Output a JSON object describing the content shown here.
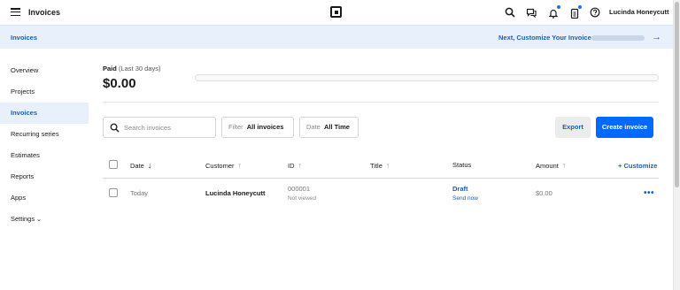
{
  "topbar": {
    "title": "Invoices",
    "user_name": "Lucinda Honeycutt"
  },
  "banner": {
    "breadcrumb": "Invoices",
    "next_step": "Next, Customize Your Invoice"
  },
  "sidebar": {
    "items": [
      {
        "label": "Overview"
      },
      {
        "label": "Projects"
      },
      {
        "label": "Invoices",
        "active": true
      },
      {
        "label": "Recurring series"
      },
      {
        "label": "Estimates"
      },
      {
        "label": "Reports"
      },
      {
        "label": "Apps"
      },
      {
        "label": "Settings"
      }
    ]
  },
  "summary": {
    "paid_label": "Paid",
    "paid_period": "(Last 30 days)",
    "paid_amount": "$0.00"
  },
  "toolbar": {
    "search_placeholder": "Search invoices",
    "filter_label": "Filter",
    "filter_value": "All invoices",
    "date_label": "Date",
    "date_value": "All Time",
    "export_label": "Export",
    "create_label": "Create invoice"
  },
  "table": {
    "columns": [
      "Date",
      "Customer",
      "ID",
      "Title",
      "Status",
      "Amount"
    ],
    "customize_label": "+ Customize",
    "rows": [
      {
        "date": "Today",
        "customer": "Lucinda Honeycutt",
        "id": "000001",
        "id_sub": "Not viewed",
        "title": "",
        "status": "Draft",
        "status_action": "Send now",
        "amount": "$0.00"
      }
    ]
  },
  "colors": {
    "accent": "#006aff",
    "link": "#1a5fb4",
    "banner_bg": "#e8f0fb"
  },
  "icons": [
    "menu-icon",
    "square-logo-icon",
    "search-icon",
    "chat-icon",
    "bell-icon",
    "clipboard-icon",
    "help-icon",
    "arrow-right-icon",
    "sort-arrow-icon",
    "more-icon"
  ]
}
